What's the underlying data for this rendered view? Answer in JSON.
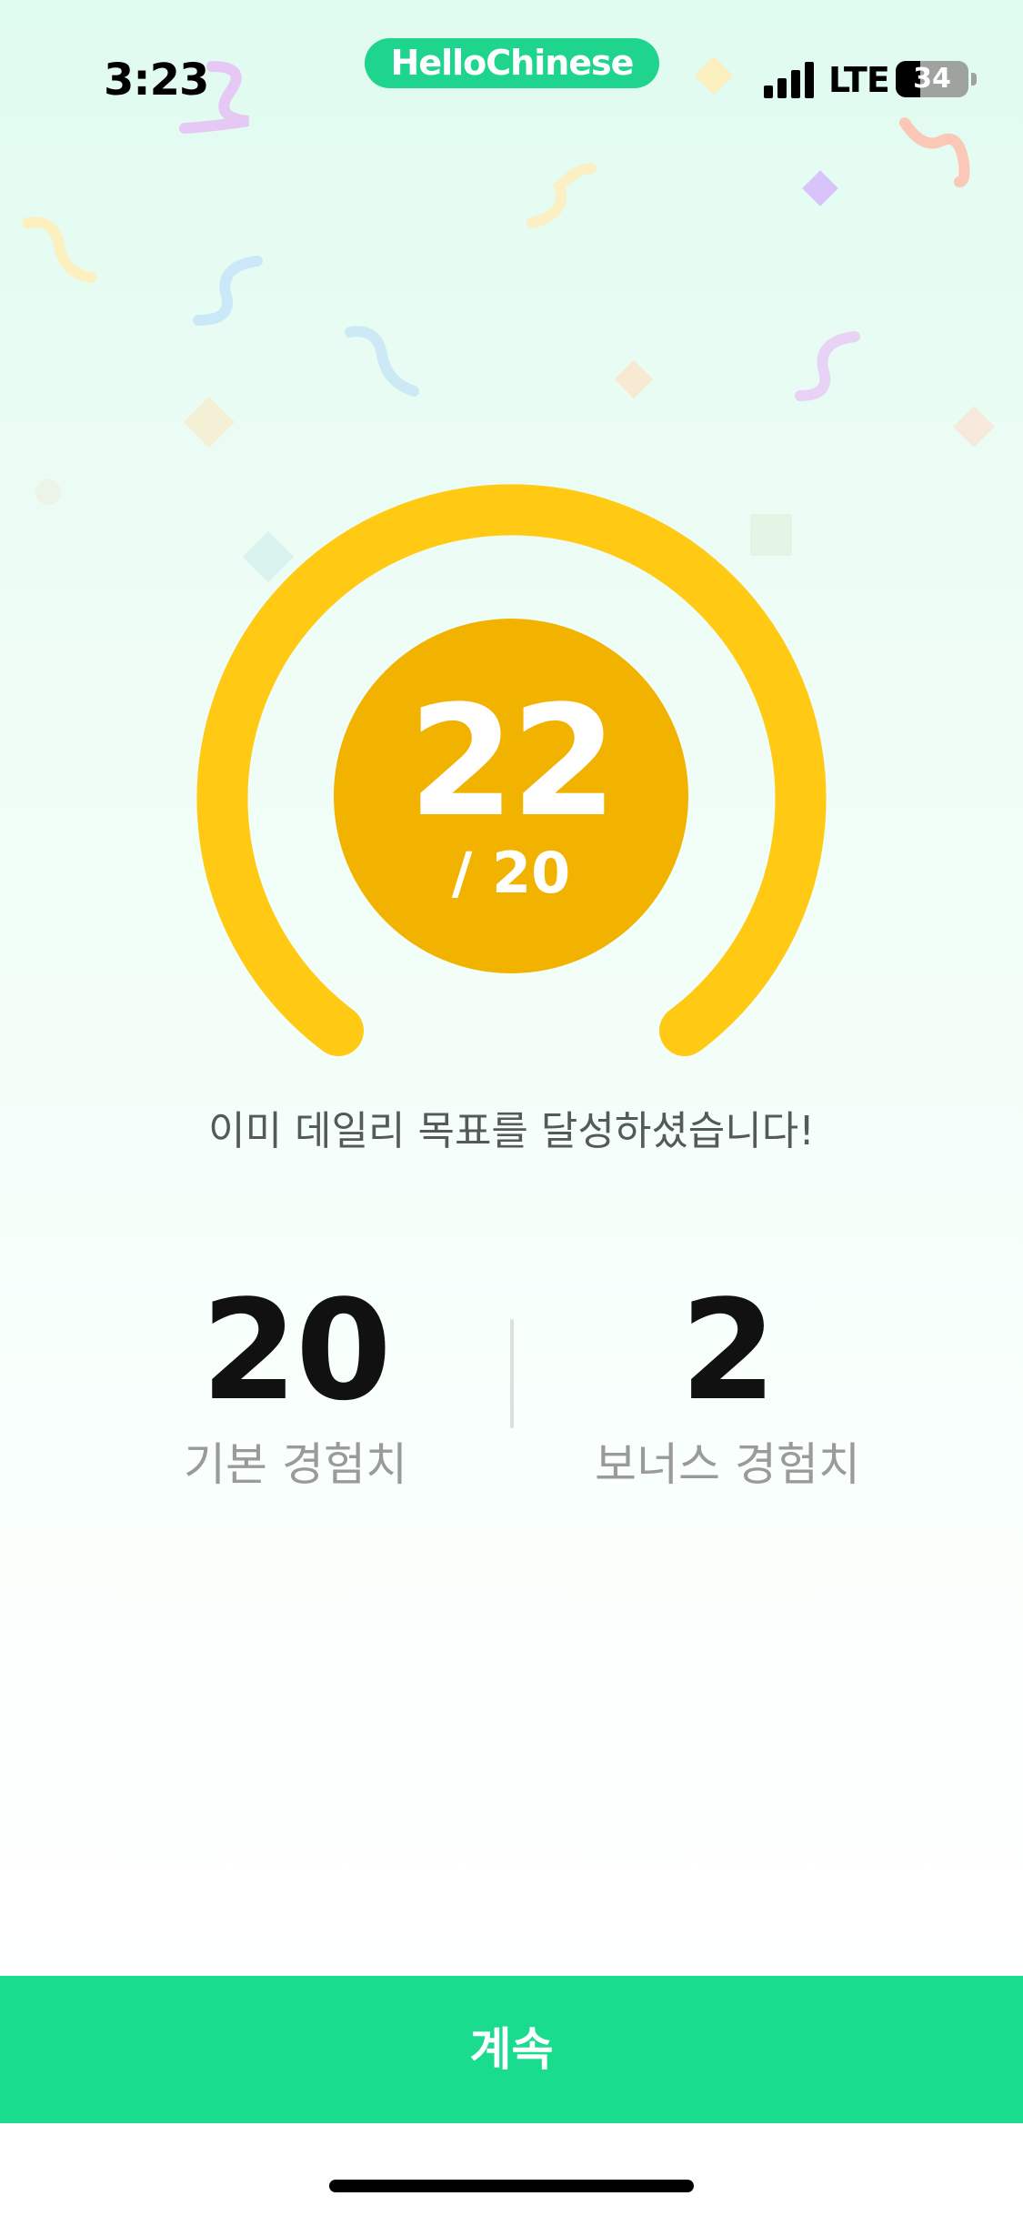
{
  "status_bar": {
    "time": "3:23",
    "app_name": "HelloChinese",
    "network": "LTE",
    "battery": "34",
    "battery_level": 0.34
  },
  "goal": {
    "current": "22",
    "target": "/ 20",
    "progress": 1.1
  },
  "message": "이미 데일리 목표를 달성하셨습니다!",
  "stats": {
    "base": {
      "value": "20",
      "label": "기본 경험치"
    },
    "bonus": {
      "value": "2",
      "label": "보너스 경험치"
    }
  },
  "continue_label": "계속",
  "colors": {
    "gauge_arc": "#ffc914",
    "score_circle": "#f2b200",
    "button": "#19dc8e",
    "app_pill": "#1fd48c"
  }
}
